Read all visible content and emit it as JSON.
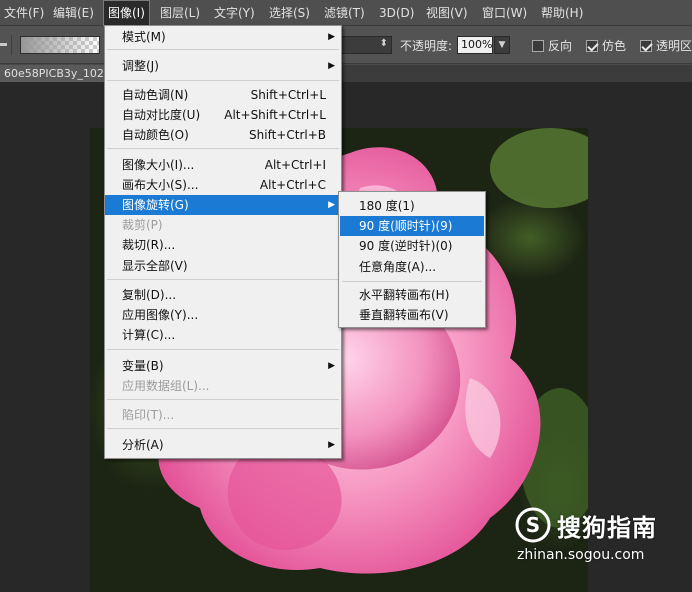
{
  "menubar": {
    "items": [
      "文件(F)",
      "编辑(E)",
      "图像(I)",
      "图层(L)",
      "文字(Y)",
      "选择(S)",
      "滤镜(T)",
      "3D(D)",
      "视图(V)",
      "窗口(W)",
      "帮助(H)"
    ],
    "active_index": 2
  },
  "options_bar": {
    "opacity_label": "不透明度:",
    "opacity_value": "100%",
    "reverse_label": "反向",
    "dither_label": "仿色",
    "transparency_label": "透明区",
    "reverse_checked": false,
    "dither_checked": true,
    "transparency_checked": true
  },
  "document": {
    "tab_title": "60e58PICB3y_102-"
  },
  "image_menu": {
    "items": [
      {
        "label": "模式(M)",
        "shortcut": "",
        "submenu": true,
        "disabled": false
      },
      {
        "label": "调整(J)",
        "shortcut": "",
        "submenu": true,
        "disabled": false
      },
      {
        "label": "自动色调(N)",
        "shortcut": "Shift+Ctrl+L",
        "submenu": false,
        "disabled": false
      },
      {
        "label": "自动对比度(U)",
        "shortcut": "Alt+Shift+Ctrl+L",
        "submenu": false,
        "disabled": false
      },
      {
        "label": "自动颜色(O)",
        "shortcut": "Shift+Ctrl+B",
        "submenu": false,
        "disabled": false
      },
      {
        "label": "图像大小(I)...",
        "shortcut": "Alt+Ctrl+I",
        "submenu": false,
        "disabled": false
      },
      {
        "label": "画布大小(S)...",
        "shortcut": "Alt+Ctrl+C",
        "submenu": false,
        "disabled": false
      },
      {
        "label": "图像旋转(G)",
        "shortcut": "",
        "submenu": true,
        "disabled": false,
        "highlighted": true
      },
      {
        "label": "裁剪(P)",
        "shortcut": "",
        "submenu": false,
        "disabled": true
      },
      {
        "label": "裁切(R)...",
        "shortcut": "",
        "submenu": false,
        "disabled": false
      },
      {
        "label": "显示全部(V)",
        "shortcut": "",
        "submenu": false,
        "disabled": false
      },
      {
        "label": "复制(D)...",
        "shortcut": "",
        "submenu": false,
        "disabled": false
      },
      {
        "label": "应用图像(Y)...",
        "shortcut": "",
        "submenu": false,
        "disabled": false
      },
      {
        "label": "计算(C)...",
        "shortcut": "",
        "submenu": false,
        "disabled": false
      },
      {
        "label": "变量(B)",
        "shortcut": "",
        "submenu": true,
        "disabled": false
      },
      {
        "label": "应用数据组(L)...",
        "shortcut": "",
        "submenu": false,
        "disabled": true
      },
      {
        "label": "陷印(T)...",
        "shortcut": "",
        "submenu": false,
        "disabled": true
      },
      {
        "label": "分析(A)",
        "shortcut": "",
        "submenu": true,
        "disabled": false
      }
    ]
  },
  "rotation_submenu": {
    "items": [
      {
        "label": "180 度(1)"
      },
      {
        "label": "90 度(顺时针)(9)",
        "highlighted": true
      },
      {
        "label": "90 度(逆时针)(0)"
      },
      {
        "label": "任意角度(A)..."
      },
      {
        "label": "水平翻转画布(H)"
      },
      {
        "label": "垂直翻转画布(V)"
      }
    ]
  },
  "watermark": {
    "brand": "搜狗指南",
    "url": "zhinan.sogou.com"
  },
  "colors": {
    "highlight": "#1a7ad4",
    "menu_bg": "#f0f0f0",
    "app_bg": "#4f4f4f"
  }
}
